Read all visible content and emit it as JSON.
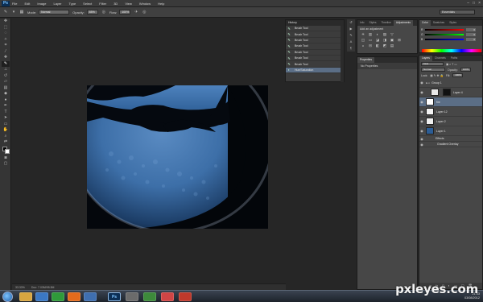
{
  "app": {
    "logo_text": "Ps",
    "window_controls": [
      "–",
      "□",
      "×"
    ]
  },
  "menu": [
    "File",
    "Edit",
    "Image",
    "Layer",
    "Type",
    "Select",
    "Filter",
    "3D",
    "View",
    "Window",
    "Help"
  ],
  "options_bar": {
    "mode_label": "Mode:",
    "mode_value": "Normal",
    "opacity_label": "Opacity:",
    "opacity_value": "85%",
    "flow_label": "Flow:",
    "flow_value": "100%",
    "workspace": "Essentials"
  },
  "status_bar": {
    "zoom": "33.33%",
    "doc": "Doc: 7.03M/95.5M"
  },
  "history": {
    "title": "History",
    "items": [
      {
        "label": "Brush Tool",
        "icon": "brush-icon"
      },
      {
        "label": "Brush Tool",
        "icon": "brush-icon"
      },
      {
        "label": "Brush Tool",
        "icon": "brush-icon"
      },
      {
        "label": "Brush Tool",
        "icon": "brush-icon"
      },
      {
        "label": "Brush Tool",
        "icon": "brush-icon"
      },
      {
        "label": "Brush Tool",
        "icon": "brush-icon"
      },
      {
        "label": "Brush Tool",
        "icon": "brush-icon"
      },
      {
        "label": "Hue/Saturation",
        "icon": "adjustment-icon"
      }
    ]
  },
  "adjustments": {
    "tabs": [
      "Info",
      "Styles",
      "Timeline",
      "Adjustments"
    ],
    "active_tab": "Adjustments",
    "title": "Add an adjustment",
    "icons": [
      "☀",
      "▥",
      "◐",
      "▨",
      "▽",
      "",
      "",
      "",
      "◫",
      "▭",
      "◪",
      "◨",
      "▣",
      "⊞",
      "◒",
      "⊟",
      "◧",
      "◩",
      "◫",
      "▤"
    ]
  },
  "properties": {
    "tabs": [
      "Properties"
    ],
    "subtitle": "No Properties"
  },
  "color_panel": {
    "tabs": [
      "Color",
      "Swatches",
      "Styles"
    ],
    "channels": [
      {
        "label": "R",
        "value": "0",
        "gradient": "linear-gradient(90deg,#000,#f00)"
      },
      {
        "label": "G",
        "value": "0",
        "gradient": "linear-gradient(90deg,#000,#0f0)"
      },
      {
        "label": "B",
        "value": "0",
        "gradient": "linear-gradient(90deg,#000,#00f)"
      }
    ]
  },
  "layers": {
    "tabs": [
      "Layers",
      "Channels",
      "Paths"
    ],
    "blend_mode": "Normal",
    "opacity_label": "Opacity:",
    "opacity_value": "100%",
    "lock_label": "Lock:",
    "fill_label": "Fill:",
    "fill_value": "100%",
    "items": [
      {
        "name": "Group 1",
        "thumb": "#555555",
        "type": "group"
      },
      {
        "name": "Layer 4",
        "thumb": "#e8e8e8",
        "type": "layer"
      },
      {
        "name": "fire",
        "thumb": "#ffffff",
        "type": "layer",
        "selected": true
      },
      {
        "name": "Layer 12",
        "thumb": "#f2f2f2",
        "type": "layer"
      },
      {
        "name": "Layer 2",
        "thumb": "#eeeeee",
        "type": "layer"
      },
      {
        "name": "Layer 1",
        "thumb": "#2c5d95",
        "type": "layer"
      },
      {
        "name": "Effects",
        "type": "effect"
      },
      {
        "name": "Gradient Overlay",
        "type": "effect"
      }
    ]
  },
  "taskbar": {
    "apps": [
      "",
      "",
      "",
      "",
      "",
      "Ps",
      "",
      "",
      "",
      ""
    ],
    "time": "21:43",
    "date": "03/08/2012"
  },
  "watermark": "pxleyes.com"
}
